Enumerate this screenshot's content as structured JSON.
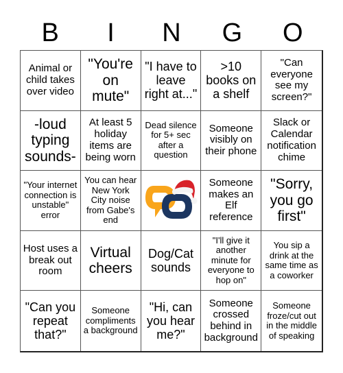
{
  "header": {
    "letters": [
      "B",
      "I",
      "N",
      "G",
      "O"
    ]
  },
  "free_space": {
    "icon": "chat-rings-logo-with-santa-hat-icon",
    "colors": {
      "orange": "#F9A51B",
      "navy": "#1C3660",
      "hat_red": "#D8232A",
      "hat_white": "#F4F4F4"
    }
  },
  "cells": [
    [
      "Animal or child takes over video",
      "\"You're on mute\"",
      "\"I have to leave right at...\"",
      ">10 books on a shelf",
      "\"Can everyone see my screen?\""
    ],
    [
      "-loud typing sounds-",
      "At least 5 holiday items are being worn",
      "Dead silence for 5+ sec after a question",
      "Someone visibly on their phone",
      "Slack or Calendar notification chime"
    ],
    [
      "\"Your internet connection is unstable\" error",
      "You can hear New York City noise from Gabe's end",
      "",
      "Someone makes an Elf reference",
      "\"Sorry, you go first\""
    ],
    [
      "Host uses a break out room",
      "Virtual cheers",
      "Dog/Cat sounds",
      "\"I'll give it another minute for everyone to hop on\"",
      "You sip a drink at the same time as a coworker"
    ],
    [
      "\"Can you repeat that?\"",
      "Someone compliments a background",
      "\"Hi, can you hear me?\"",
      "Someone crossed behind in background",
      "Someone froze/cut out in the middle of speaking"
    ]
  ]
}
